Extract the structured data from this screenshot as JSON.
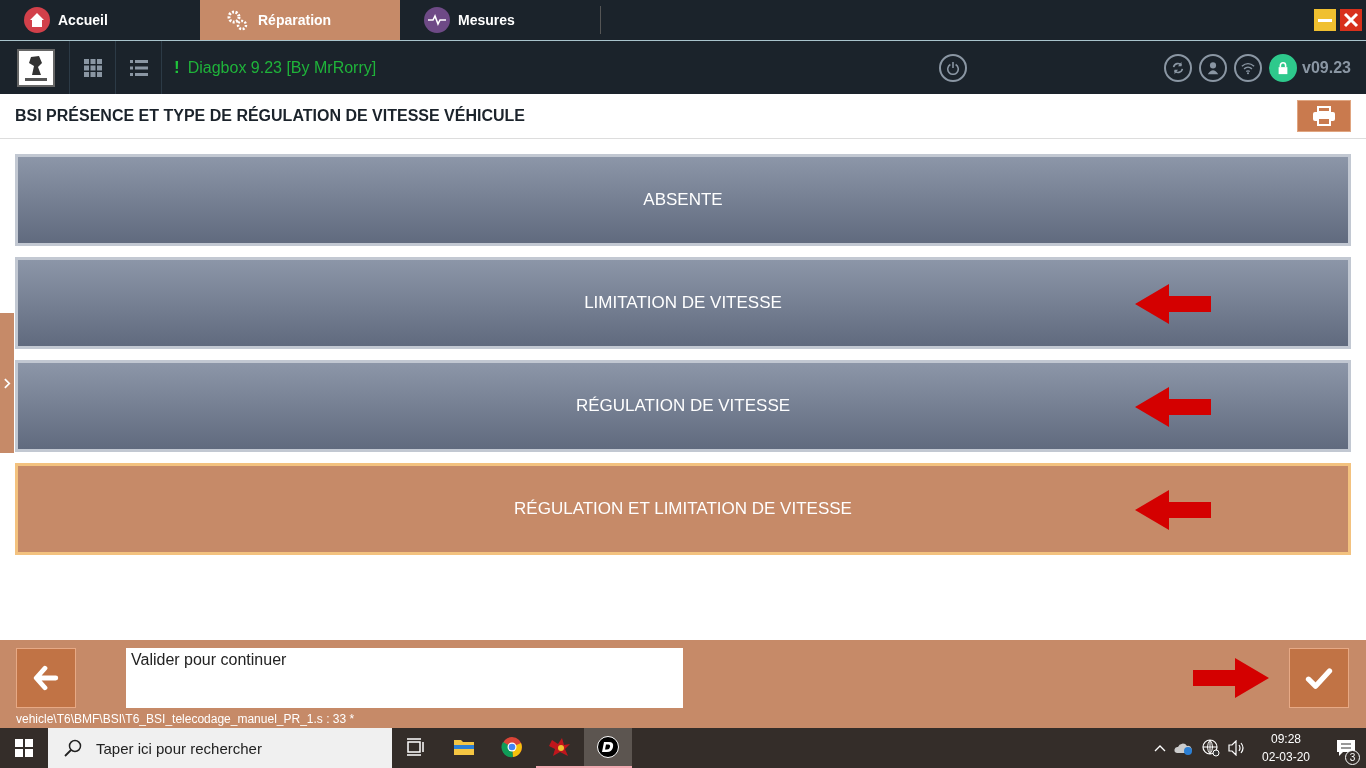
{
  "tabs": [
    {
      "label": "Accueil",
      "selected": false
    },
    {
      "label": "Réparation",
      "selected": true
    },
    {
      "label": "Mesures",
      "selected": false
    }
  ],
  "toolbar": {
    "status_mark": "!",
    "status_text": "Diagbox 9.23 [By MrRorry]",
    "version": "v09.23"
  },
  "page_title": "BSI PRÉSENCE ET TYPE DE RÉGULATION DE VITESSE VÉHICULE",
  "options": [
    {
      "label": "ABSENTE",
      "selected": false,
      "arrow": false
    },
    {
      "label": "LIMITATION DE VITESSE",
      "selected": false,
      "arrow": true
    },
    {
      "label": "RÉGULATION DE VITESSE",
      "selected": false,
      "arrow": true
    },
    {
      "label": "RÉGULATION ET LIMITATION DE VITESSE",
      "selected": true,
      "arrow": true
    }
  ],
  "footer": {
    "message": "Valider pour continuer",
    "path": "vehicle\\T6\\BMF\\BSI\\T6_BSI_telecodage_manuel_PR_1.s : 33 *",
    "confirm_arrow": true
  },
  "taskbar": {
    "search_placeholder": "Taper ici pour rechercher",
    "apps": [
      {
        "running": false,
        "selected": false
      },
      {
        "running": false,
        "selected": false
      },
      {
        "running": false,
        "selected": false
      },
      {
        "running": true,
        "selected": false
      },
      {
        "running": true,
        "selected": true
      }
    ],
    "time": "09:28",
    "date": "02-03-20",
    "notifications": "3"
  }
}
